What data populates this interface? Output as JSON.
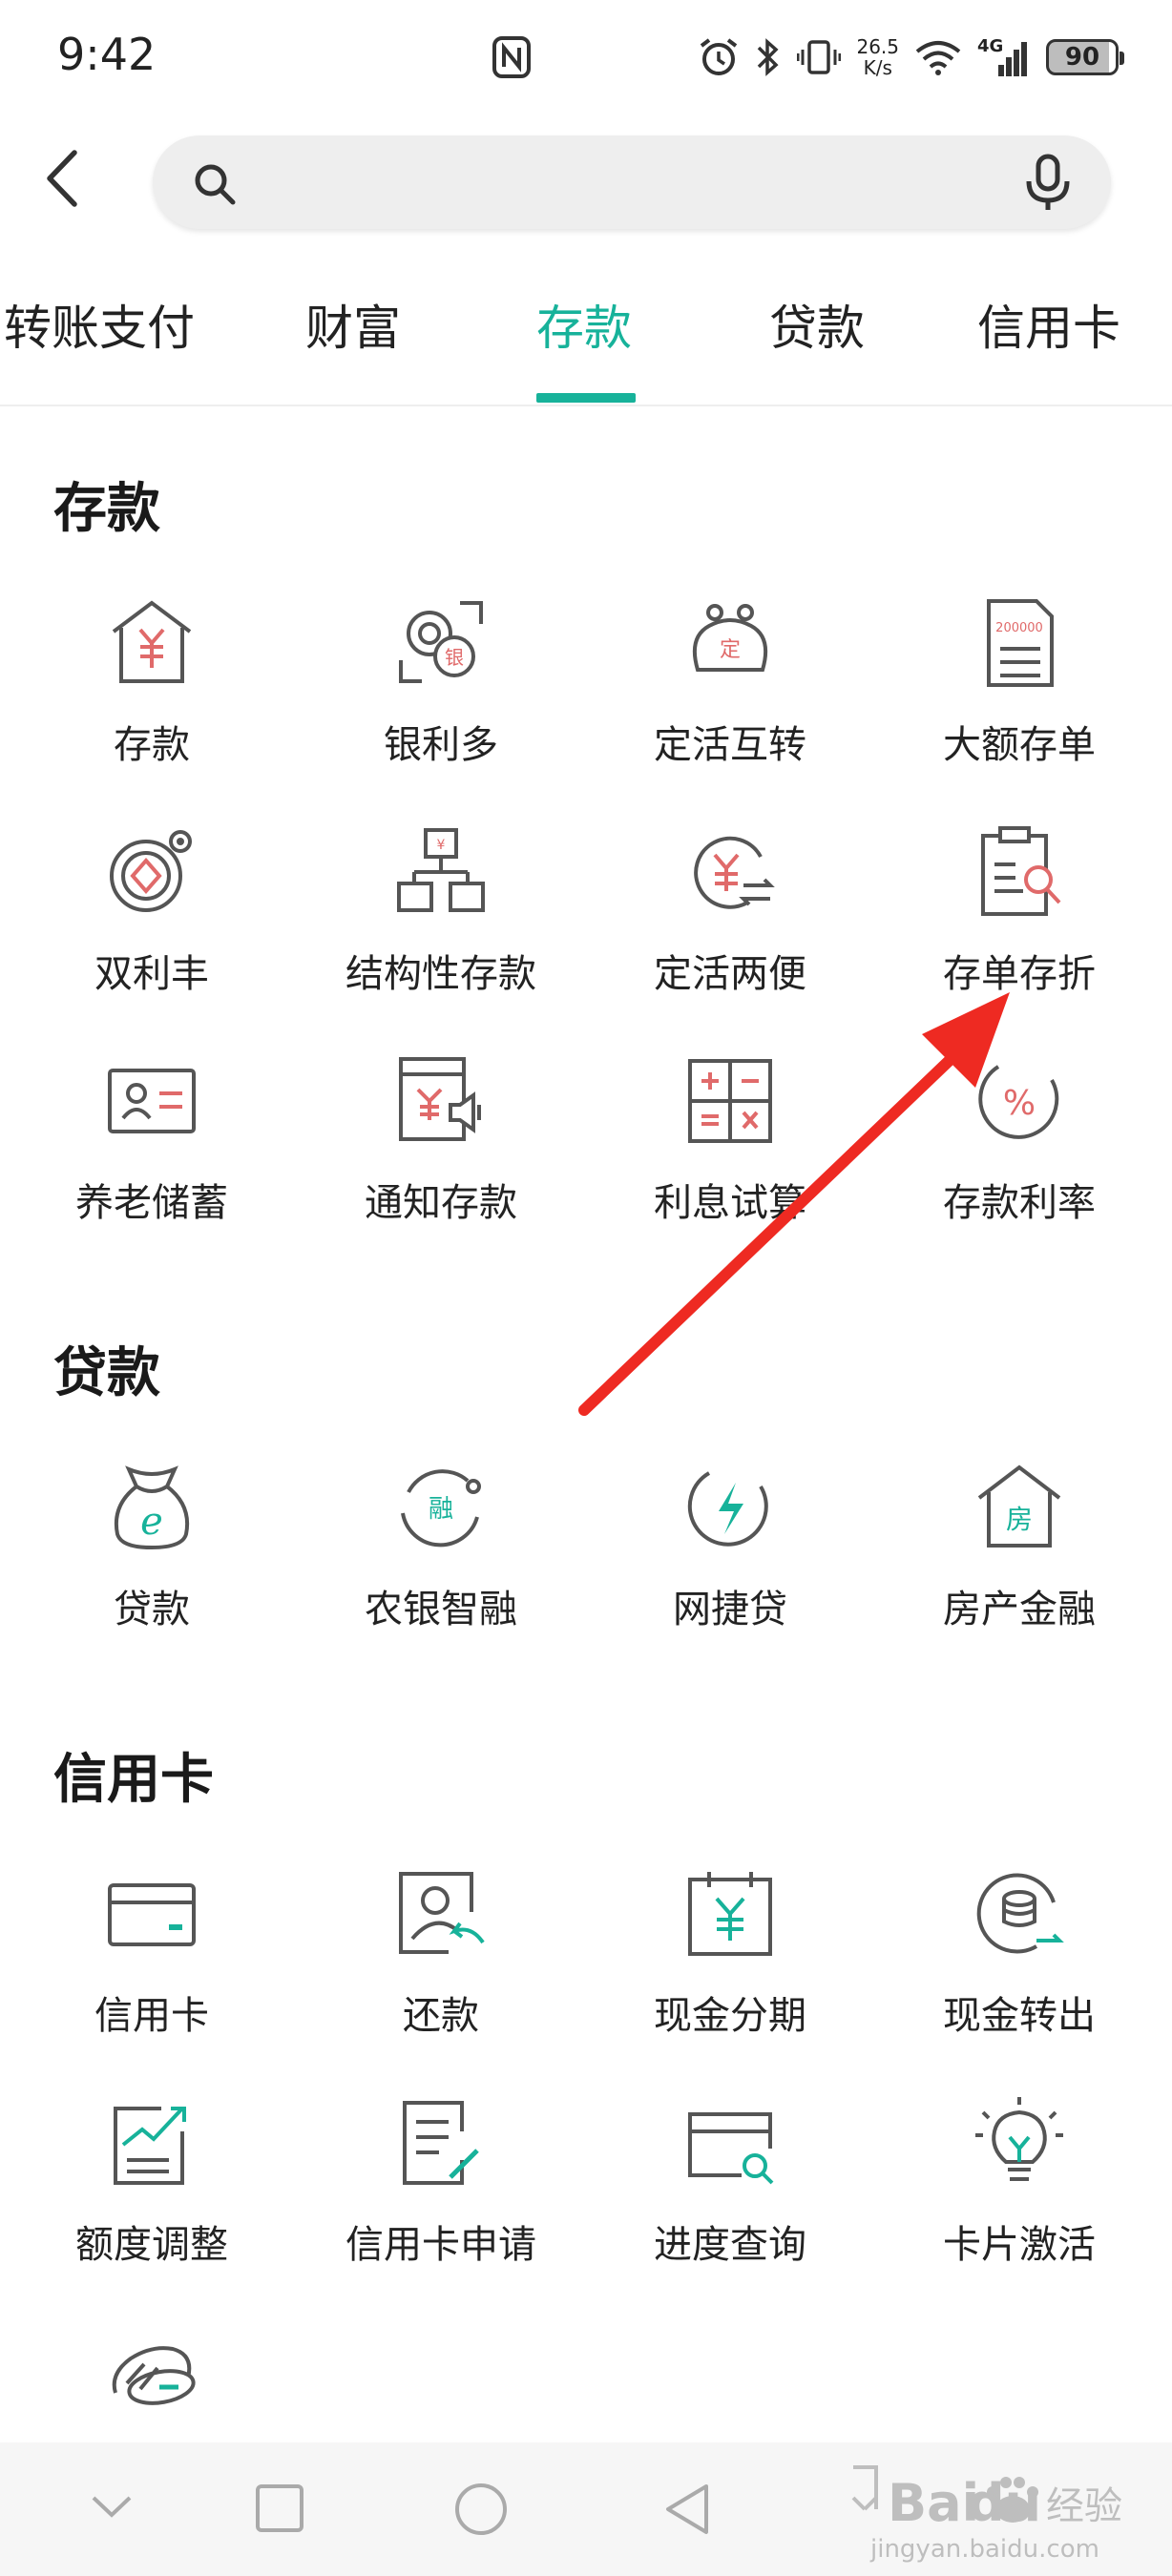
{
  "status_bar": {
    "time": "9:42",
    "net_speed_top": "26.5",
    "net_speed_bottom": "K/s",
    "signal_label": "4G",
    "battery": "90"
  },
  "search": {
    "placeholder": ""
  },
  "tabs": [
    {
      "label": "转账支付",
      "active": false
    },
    {
      "label": "财富",
      "active": false
    },
    {
      "label": "存款",
      "active": true
    },
    {
      "label": "贷款",
      "active": false
    },
    {
      "label": "信用卡",
      "active": false
    }
  ],
  "sections": {
    "deposit": {
      "title": "存款",
      "items": [
        {
          "label": "存款",
          "icon": "house-yuan-icon"
        },
        {
          "label": "银利多",
          "icon": "coin-bank-icon"
        },
        {
          "label": "定活互转",
          "icon": "purse-icon"
        },
        {
          "label": "大额存单",
          "icon": "certificate-document-icon"
        },
        {
          "label": "双利丰",
          "icon": "target-coin-icon"
        },
        {
          "label": "结构性存款",
          "icon": "structure-icon"
        },
        {
          "label": "定活两便",
          "icon": "exchange-yuan-icon"
        },
        {
          "label": "存单存折",
          "icon": "clipboard-search-icon"
        },
        {
          "label": "养老储蓄",
          "icon": "id-card-icon"
        },
        {
          "label": "通知存款",
          "icon": "notice-speaker-icon"
        },
        {
          "label": "利息试算",
          "icon": "calculator-icon"
        },
        {
          "label": "存款利率",
          "icon": "percent-icon"
        }
      ]
    },
    "loan": {
      "title": "贷款",
      "items": [
        {
          "label": "贷款",
          "icon": "money-bag-icon"
        },
        {
          "label": "农银智融",
          "icon": "fusion-cycle-icon"
        },
        {
          "label": "网捷贷",
          "icon": "lightning-icon"
        },
        {
          "label": "房产金融",
          "icon": "house-icon"
        }
      ]
    },
    "credit": {
      "title": "信用卡",
      "items": [
        {
          "label": "信用卡",
          "icon": "credit-card-icon"
        },
        {
          "label": "还款",
          "icon": "repay-user-icon"
        },
        {
          "label": "现金分期",
          "icon": "calendar-yuan-icon"
        },
        {
          "label": "现金转出",
          "icon": "coins-transfer-icon"
        },
        {
          "label": "额度调整",
          "icon": "chart-adjust-icon"
        },
        {
          "label": "信用卡申请",
          "icon": "application-form-icon"
        },
        {
          "label": "进度查询",
          "icon": "card-search-icon"
        },
        {
          "label": "卡片激活",
          "icon": "lightbulb-icon"
        }
      ]
    }
  },
  "extra_item": {
    "icon": "card-stack-icon"
  },
  "colors": {
    "accent": "#17b29a",
    "icon_gray": "#555555",
    "icon_red": "#e06a6a",
    "arrow": "#ee2a22"
  }
}
